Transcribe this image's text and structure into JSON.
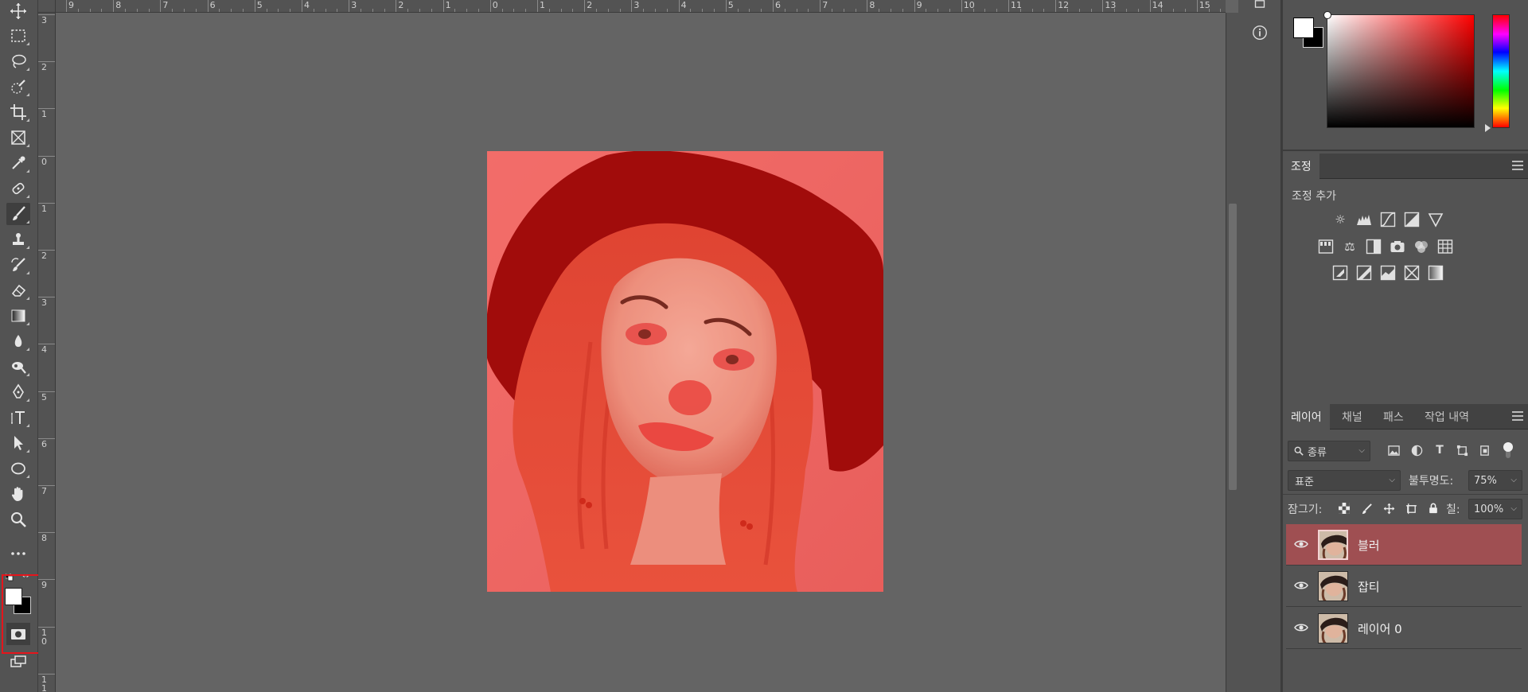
{
  "ruler_top": {
    "labels": [
      "9",
      "8",
      "7",
      "6",
      "5",
      "4",
      "3",
      "2",
      "1",
      "0",
      "1",
      "2",
      "3",
      "4",
      "5",
      "6",
      "7",
      "8",
      "9",
      "10",
      "11",
      "12",
      "13",
      "14",
      "15"
    ]
  },
  "ruler_left": {
    "labels": [
      "3",
      "2",
      "1",
      "0",
      "1",
      "2",
      "3",
      "4",
      "5",
      "6",
      "7",
      "8",
      "9",
      "1 0",
      "1 1"
    ]
  },
  "toolbar": {
    "tools": [
      "move-tool",
      "marquee-tool",
      "lasso-tool",
      "quick-select-tool",
      "crop-tool",
      "frame-tool",
      "eyedropper-tool",
      "healing-brush-tool",
      "brush-tool",
      "clone-stamp-tool",
      "history-brush-tool",
      "eraser-tool",
      "gradient-tool",
      "blur-tool",
      "dodge-tool",
      "pen-tool",
      "type-tool",
      "path-select-tool",
      "ellipse-tool",
      "hand-tool",
      "zoom-tool",
      "more-tools"
    ],
    "active_tool": "brush-tool"
  },
  "colors": {
    "foreground": "#ffffff",
    "background": "#000000",
    "highlight": "#e5151b",
    "active_layer": "#9f4f52"
  },
  "adjustments": {
    "tab": "조정",
    "add_label": "조정 추가"
  },
  "layers_panel": {
    "tabs": [
      "레이어",
      "채널",
      "패스",
      "작업 내역"
    ],
    "filter": "종류",
    "blend_mode": "표준",
    "opacity_label": "불투명도:",
    "opacity": "75%",
    "lock_label": "잠그기:",
    "fill_label": "칠:",
    "fill": "100%",
    "layers": [
      {
        "name": "블러",
        "active": true
      },
      {
        "name": "잡티",
        "active": false
      },
      {
        "name": "레이어 0",
        "active": false
      }
    ]
  }
}
